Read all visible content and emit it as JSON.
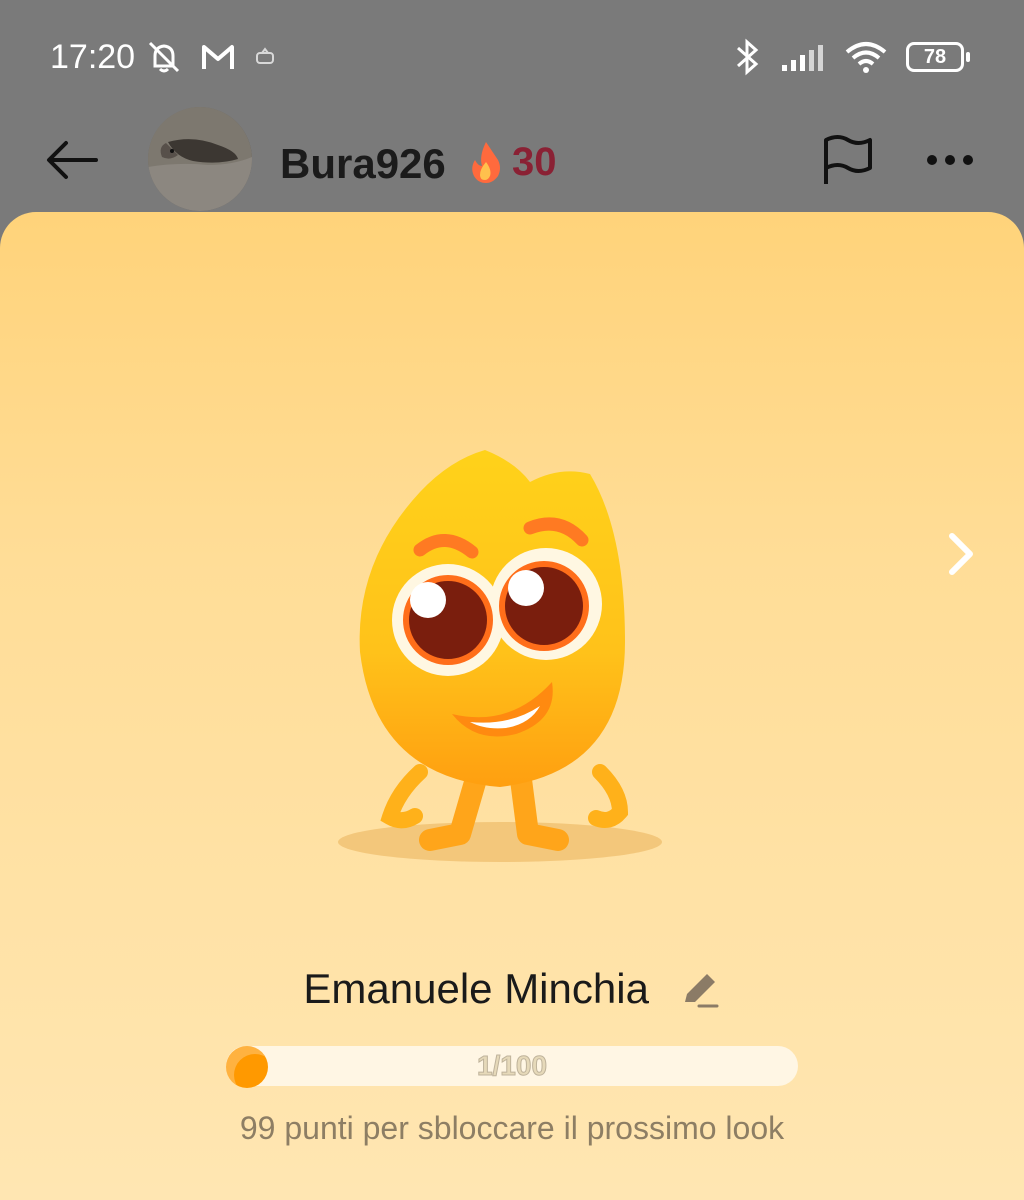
{
  "status_bar": {
    "time": "17:20",
    "battery": "78",
    "icons_left": [
      "bell-off-icon",
      "gmail-icon",
      "app-notification-icon"
    ],
    "icons_right": [
      "bluetooth-icon",
      "signal-icon",
      "wifi-icon",
      "battery-icon"
    ]
  },
  "header": {
    "username": "Bura926",
    "streak": "30",
    "streak_icon": "fire-icon",
    "back_icon": "back-arrow-icon",
    "flag_icon": "flag-icon",
    "more_icon": "more-icon"
  },
  "profile": {
    "character_name": "Emanuele Minchia",
    "progress_text": "1/100",
    "progress_value": 0.01,
    "hint": "99 punti per sbloccare il prossimo look"
  },
  "colors": {
    "card_top": "#ffd37a",
    "card_bottom": "#ffe6b2",
    "progress_fill": "#ff9900",
    "streak_color": "#8a2134"
  }
}
